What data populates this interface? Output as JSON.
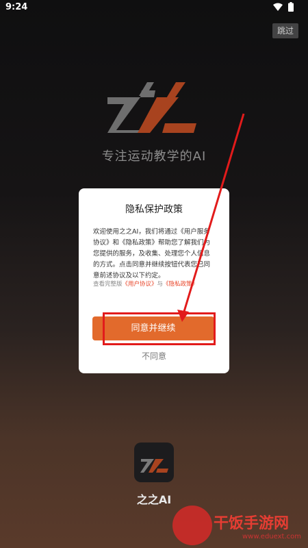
{
  "status_bar": {
    "time": "9:24"
  },
  "skip_label": "跳过",
  "slogan": "专注运动教学的AI",
  "dialog": {
    "title": "隐私保护政策",
    "body": "欢迎使用之之AI，我们将通过《用户服务协议》和《隐私政策》帮助您了解我们为您提供的服务，及收集、处理您个人信息的方式。点击同意并继续按钮代表您已同意前述协议及以下约定。",
    "links_prefix": "查看完整版",
    "user_agreement": "《用户协议》",
    "links_and": "与",
    "privacy_policy": "《隐私政策》",
    "agree_label": "同意并继续",
    "disagree_label": "不同意"
  },
  "app_name": "之之AI",
  "watermark": {
    "text": "干饭手游网",
    "url": "www.eduext.com"
  },
  "colors": {
    "accent": "#e26a2c",
    "annotation": "#e21b1b",
    "link": "#e8462a"
  },
  "icons": {
    "wifi": "wifi-icon",
    "battery": "battery-icon",
    "logo": "zz-logo"
  }
}
